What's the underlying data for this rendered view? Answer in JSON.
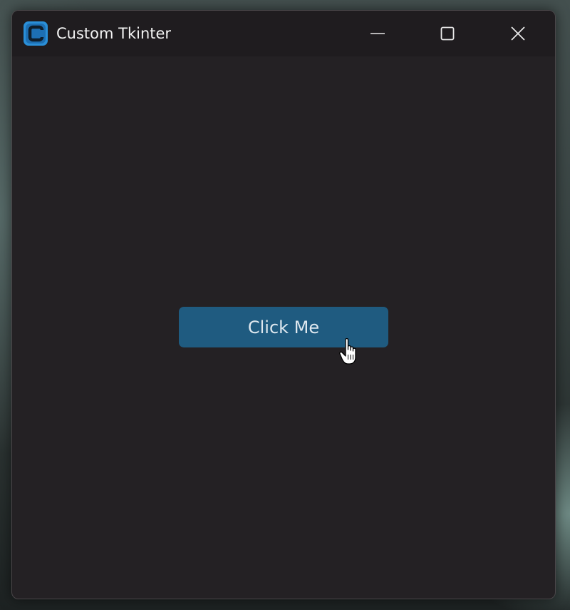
{
  "window": {
    "title": "Custom Tkinter",
    "controls": {
      "minimize": "minimize-icon",
      "maximize": "maximize-icon",
      "close": "close-icon"
    }
  },
  "content": {
    "button_label": "Click Me"
  },
  "colors": {
    "window_bg": "#242124",
    "titlebar_bg": "#1f1c1f",
    "button_bg": "#1f5b80",
    "button_text": "#dfe8ef",
    "app_icon_accent": "#2a8fd8"
  },
  "icons": {
    "app": "customtkinter-logo-icon",
    "pointer": "hand-pointer-cursor-icon"
  }
}
